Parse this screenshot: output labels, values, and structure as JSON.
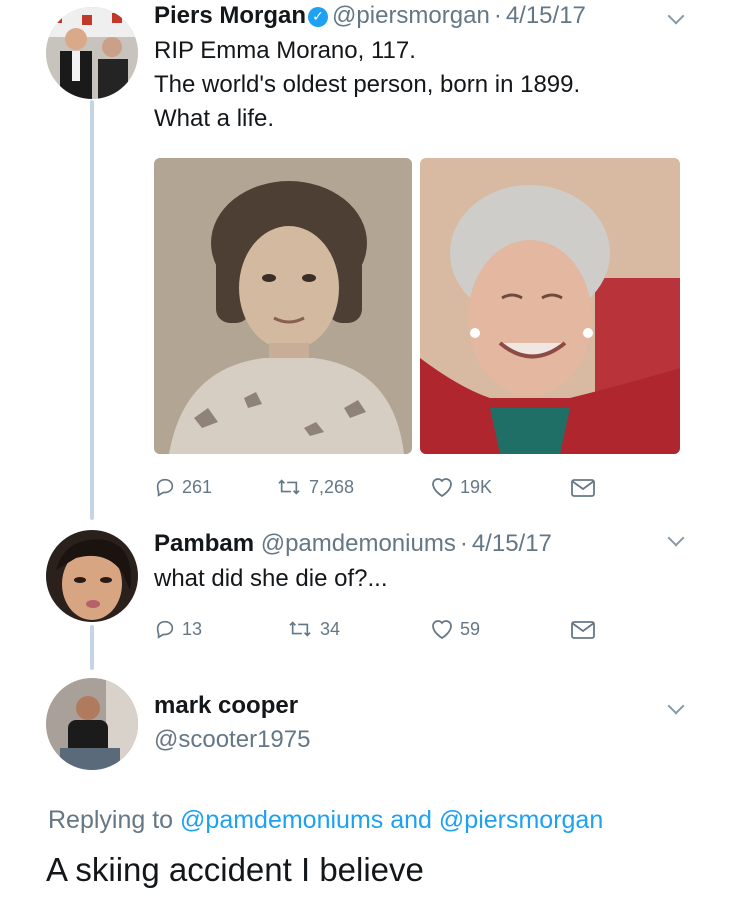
{
  "tweets": [
    {
      "name": "Piers Morgan",
      "handle": "@piersmorgan",
      "date": "4/15/17",
      "text": "RIP Emma Morano, 117.\nThe world's oldest person, born in 1899.\nWhat a life.",
      "stats": {
        "replies": "261",
        "retweets": "7,268",
        "likes": "19K"
      }
    },
    {
      "name": "Pambam",
      "handle": "@pamdemoniums",
      "date": "4/15/17",
      "text": "what did she die of?...",
      "stats": {
        "replies": "13",
        "retweets": "34",
        "likes": "59"
      }
    },
    {
      "name": "mark cooper",
      "handle": "@scooter1975"
    }
  ],
  "separator": "·",
  "reply_context": {
    "prefix": "Replying to",
    "mention1": "@pamdemoniums",
    "conjunction": "and",
    "mention2": "@piersmorgan"
  },
  "reply_text": "A skiing accident I believe",
  "colors": {
    "link": "#1da1f2",
    "secondary_text": "#657786",
    "thread_line": "#c4d6e6",
    "verified_badge": "#1da1f2"
  },
  "icons": [
    "verified-badge-icon",
    "chevron-down-icon",
    "reply-icon",
    "retweet-icon",
    "like-icon",
    "direct-message-icon"
  ]
}
